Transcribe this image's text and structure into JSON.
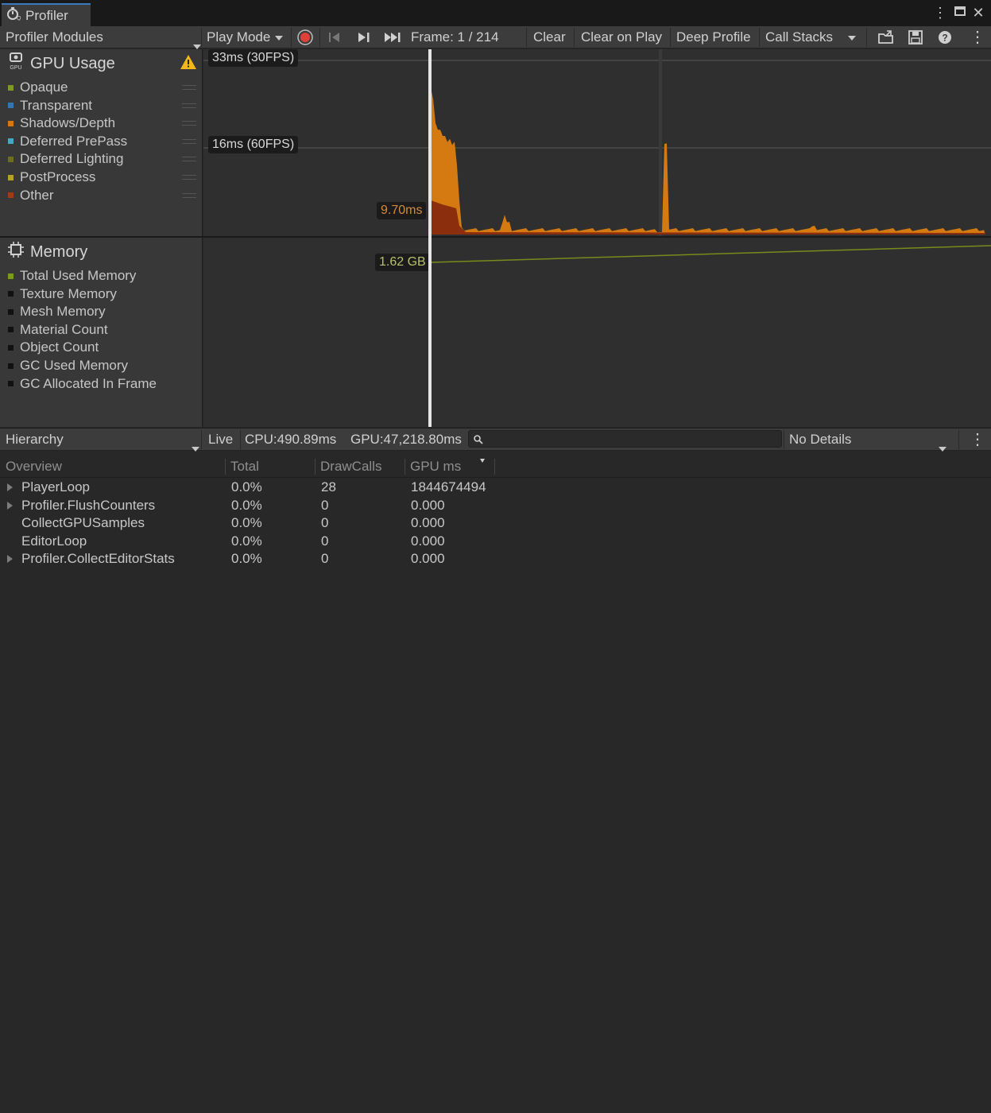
{
  "window": {
    "title": "Profiler"
  },
  "toolbar": {
    "modules_label": "Profiler Modules",
    "play_mode_label": "Play Mode",
    "frame_label": "Frame: 1 / 214",
    "clear_label": "Clear",
    "clear_on_play_label": "Clear on Play",
    "deep_profile_label": "Deep Profile",
    "call_stacks_label": "Call Stacks"
  },
  "gpu_module": {
    "title": "GPU Usage",
    "warning_icon": "warning-icon",
    "legend": [
      {
        "label": "Opaque",
        "color": "#7b9a1e"
      },
      {
        "label": "Transparent",
        "color": "#2f77b5"
      },
      {
        "label": "Shadows/Depth",
        "color": "#d47a11"
      },
      {
        "label": "Deferred PrePass",
        "color": "#43a8c4"
      },
      {
        "label": "Deferred Lighting",
        "color": "#6e6e1c"
      },
      {
        "label": "PostProcess",
        "color": "#b8a21a"
      },
      {
        "label": "Other",
        "color": "#a33a14"
      }
    ],
    "line_30fps": "33ms (30FPS)",
    "line_60fps": "16ms (60FPS)",
    "selected_value": "9.70ms"
  },
  "memory_module": {
    "title": "Memory",
    "legend": [
      {
        "label": "Total Used Memory",
        "color": "#7b9a1e"
      },
      {
        "label": "Texture Memory",
        "color": "#111111"
      },
      {
        "label": "Mesh Memory",
        "color": "#111111"
      },
      {
        "label": "Material Count",
        "color": "#111111"
      },
      {
        "label": "Object Count",
        "color": "#111111"
      },
      {
        "label": "GC Used Memory",
        "color": "#111111"
      },
      {
        "label": "GC Allocated In Frame",
        "color": "#111111"
      }
    ],
    "selected_value": "1.62 GB"
  },
  "details": {
    "view_label": "Hierarchy",
    "live_label": "Live",
    "cpu_label": "CPU:490.89ms",
    "gpu_label": "GPU:47,218.80ms",
    "search_value": "",
    "details_select": "No Details",
    "columns": {
      "overview": "Overview",
      "total": "Total",
      "drawcalls": "DrawCalls",
      "gpu_ms": "GPU ms"
    },
    "rows": [
      {
        "name": "PlayerLoop",
        "total": "0.0%",
        "drawcalls": "28",
        "gpu": "1844674494",
        "expandable": true
      },
      {
        "name": "Profiler.FlushCounters",
        "total": "0.0%",
        "drawcalls": "0",
        "gpu": "0.000",
        "expandable": true
      },
      {
        "name": "CollectGPUSamples",
        "total": "0.0%",
        "drawcalls": "0",
        "gpu": "0.000",
        "expandable": false
      },
      {
        "name": "EditorLoop",
        "total": "0.0%",
        "drawcalls": "0",
        "gpu": "0.000",
        "expandable": false
      },
      {
        "name": "Profiler.CollectEditorStats",
        "total": "0.0%",
        "drawcalls": "0",
        "gpu": "0.000",
        "expandable": true
      }
    ]
  }
}
